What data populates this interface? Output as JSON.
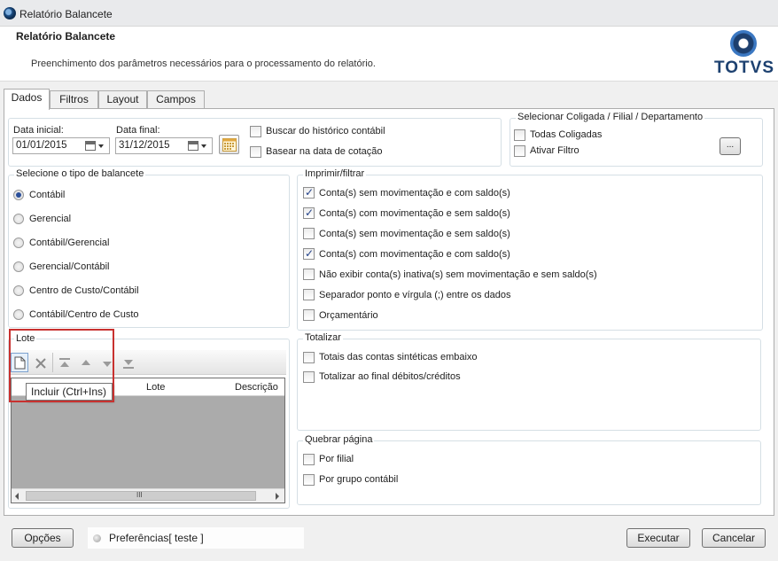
{
  "window": {
    "title": "Relatório Balancete"
  },
  "header": {
    "title": "Relatório Balancete",
    "subtitle": "Preenchimento dos parâmetros necessários para o processamento do relatório.",
    "logo_text": "TOTVS"
  },
  "tabs": [
    {
      "label": "Dados",
      "active": true
    },
    {
      "label": "Filtros",
      "active": false
    },
    {
      "label": "Layout",
      "active": false
    },
    {
      "label": "Campos",
      "active": false
    }
  ],
  "dates": {
    "start_label": "Data inicial:",
    "start_value": "01/01/2015",
    "end_label": "Data final:",
    "end_value": "31/12/2015"
  },
  "options_top": [
    {
      "label": "Buscar do histórico contábil",
      "checked": false
    },
    {
      "label": "Basear na data de cotação",
      "checked": false
    }
  ],
  "coligada": {
    "title": "Selecionar Coligada / Filial / Departamento",
    "items": [
      {
        "label": "Todas Coligadas",
        "checked": false
      },
      {
        "label": "Ativar Filtro",
        "checked": false
      }
    ],
    "ellipsis_label": "..."
  },
  "tipo_balancete": {
    "title": "Selecione o tipo de balancete",
    "options": [
      {
        "label": "Contábil",
        "selected": true
      },
      {
        "label": "Gerencial",
        "selected": false
      },
      {
        "label": "Contábil/Gerencial",
        "selected": false
      },
      {
        "label": "Gerencial/Contábil",
        "selected": false
      },
      {
        "label": "Centro de Custo/Contábil",
        "selected": false
      },
      {
        "label": "Contábil/Centro de Custo",
        "selected": false
      }
    ]
  },
  "imprimir": {
    "title": "Imprimir/filtrar",
    "items": [
      {
        "label": "Conta(s) sem movimentação e com saldo(s)",
        "checked": true
      },
      {
        "label": "Conta(s) com movimentação e sem saldo(s)",
        "checked": true
      },
      {
        "label": "Conta(s) sem movimentação e sem saldo(s)",
        "checked": false
      },
      {
        "label": "Conta(s) com movimentação e com saldo(s)",
        "checked": true
      },
      {
        "label": "Não exibir conta(s) inativa(s) sem movimentação e sem saldo(s)",
        "checked": false
      },
      {
        "label": "Separador ponto e vírgula (;) entre os dados",
        "checked": false
      },
      {
        "label": "Orçamentário",
        "checked": false
      }
    ]
  },
  "lote": {
    "title": "Lote",
    "columns": [
      "Lote",
      "Descrição"
    ],
    "tooltip": "Incluir (Ctrl+Ins)",
    "scroll_grip": "III"
  },
  "totalizar": {
    "title": "Totalizar",
    "items": [
      {
        "label": "Totais das contas sintéticas embaixo",
        "checked": false
      },
      {
        "label": "Totalizar ao final débitos/créditos",
        "checked": false
      }
    ]
  },
  "quebrar": {
    "title": "Quebrar página",
    "items": [
      {
        "label": "Por filial",
        "checked": false
      },
      {
        "label": "Por grupo contábil",
        "checked": false
      }
    ]
  },
  "footer": {
    "options_button": "Opções",
    "preferences": "Preferências[ teste ]",
    "execute_button": "Executar",
    "cancel_button": "Cancelar"
  }
}
